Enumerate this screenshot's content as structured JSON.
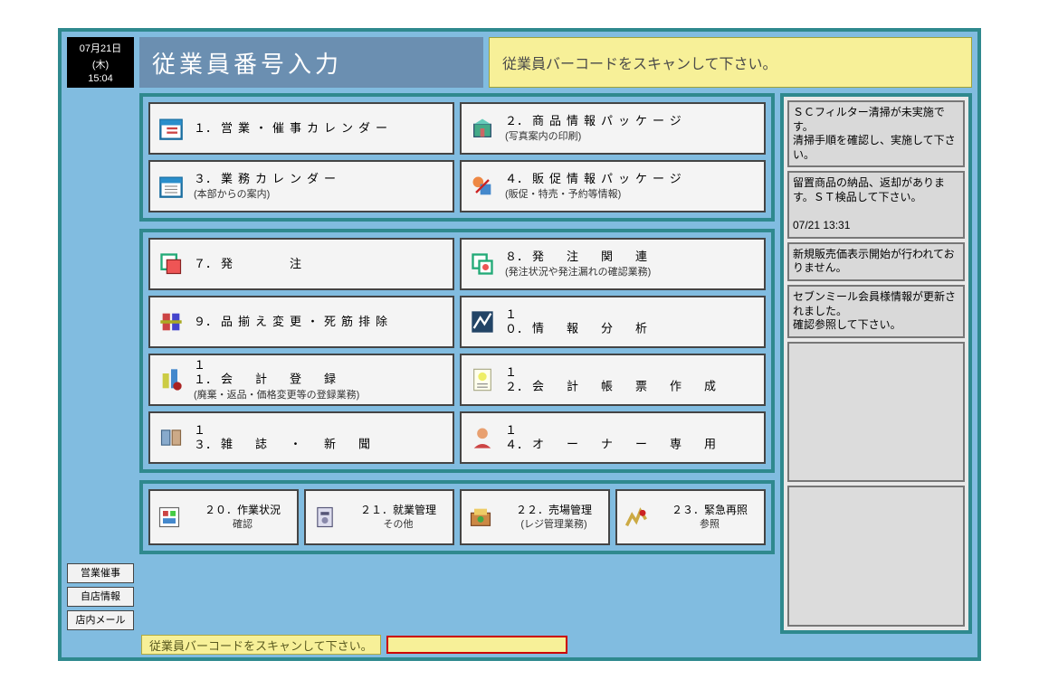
{
  "clock": {
    "date": "07月21日",
    "day": "(木)",
    "time": "15:04"
  },
  "title": "従業員番号入力",
  "scan_message": "従業員バーコードをスキャンして下さい。",
  "side_buttons": [
    "営業催事",
    "自店情報",
    "店内メール"
  ],
  "groups": [
    {
      "rows": [
        [
          {
            "num": "１．",
            "title": "営業・催事カレンダー",
            "sub": "",
            "icon": "calendar"
          },
          {
            "num": "２．",
            "title": "商品情報パッケージ",
            "sub": "(写真案内の印刷)",
            "icon": "package"
          }
        ],
        [
          {
            "num": "３．",
            "title": "業務カレンダー",
            "sub": "(本部からの案内)",
            "icon": "calendar"
          },
          {
            "num": "４．",
            "title": "販促情報パッケージ",
            "sub": "(販促・特売・予約等情報)",
            "icon": "promo"
          }
        ]
      ]
    },
    {
      "rows": [
        [
          {
            "num": "７．",
            "title": "発　　　注",
            "sub": "",
            "icon": "order"
          },
          {
            "num": "８．",
            "title": "発　注　関　連",
            "sub": "(発注状況や発注漏れの確認業務)",
            "icon": "order-rel"
          }
        ],
        [
          {
            "num": "９．",
            "title": "品揃え変更・死筋排除",
            "sub": "",
            "icon": "assort"
          },
          {
            "num": "１０．",
            "title": "情　報　分　析",
            "sub": "",
            "icon": "analysis"
          }
        ],
        [
          {
            "num": "１１．",
            "title": "会　計　登　録",
            "sub": "(廃棄・返品・価格変更等の登録業務)",
            "icon": "account"
          },
          {
            "num": "１２．",
            "title": "会　計　帳　票　作　成",
            "sub": "",
            "icon": "report"
          }
        ],
        [
          {
            "num": "１３．",
            "title": "雑　誌　・　新　聞",
            "sub": "",
            "icon": "magazine"
          },
          {
            "num": "１４．",
            "title": "オ　ー　ナ　ー　専　用",
            "sub": "",
            "icon": "owner"
          }
        ]
      ]
    }
  ],
  "bottom_row": [
    {
      "num": "２０．",
      "title": "作業状況",
      "sub": "確認",
      "icon": "work"
    },
    {
      "num": "２１．",
      "title": "就業管理",
      "sub": "その他",
      "icon": "labor"
    },
    {
      "num": "２２．",
      "title": "売場管理",
      "sub": "(レジ管理業務)",
      "icon": "sales"
    },
    {
      "num": "２３．",
      "title": "緊急再照",
      "sub": "参照",
      "icon": "emergency"
    }
  ],
  "notices": [
    "ＳＣフィルター清掃が未実施です。\n清掃手順を確認し、実施して下さい。",
    "留置商品の納品、返却があります。ＳＴ検品して下さい。\n\n07/21 13:31",
    "新規販売価表示開始が行われておりません。",
    "セブンミール会員様情報が更新されました。\n確認参照して下さい。"
  ],
  "footer_msg": "従業員バーコードをスキャンして下さい。",
  "footer_input_value": ""
}
